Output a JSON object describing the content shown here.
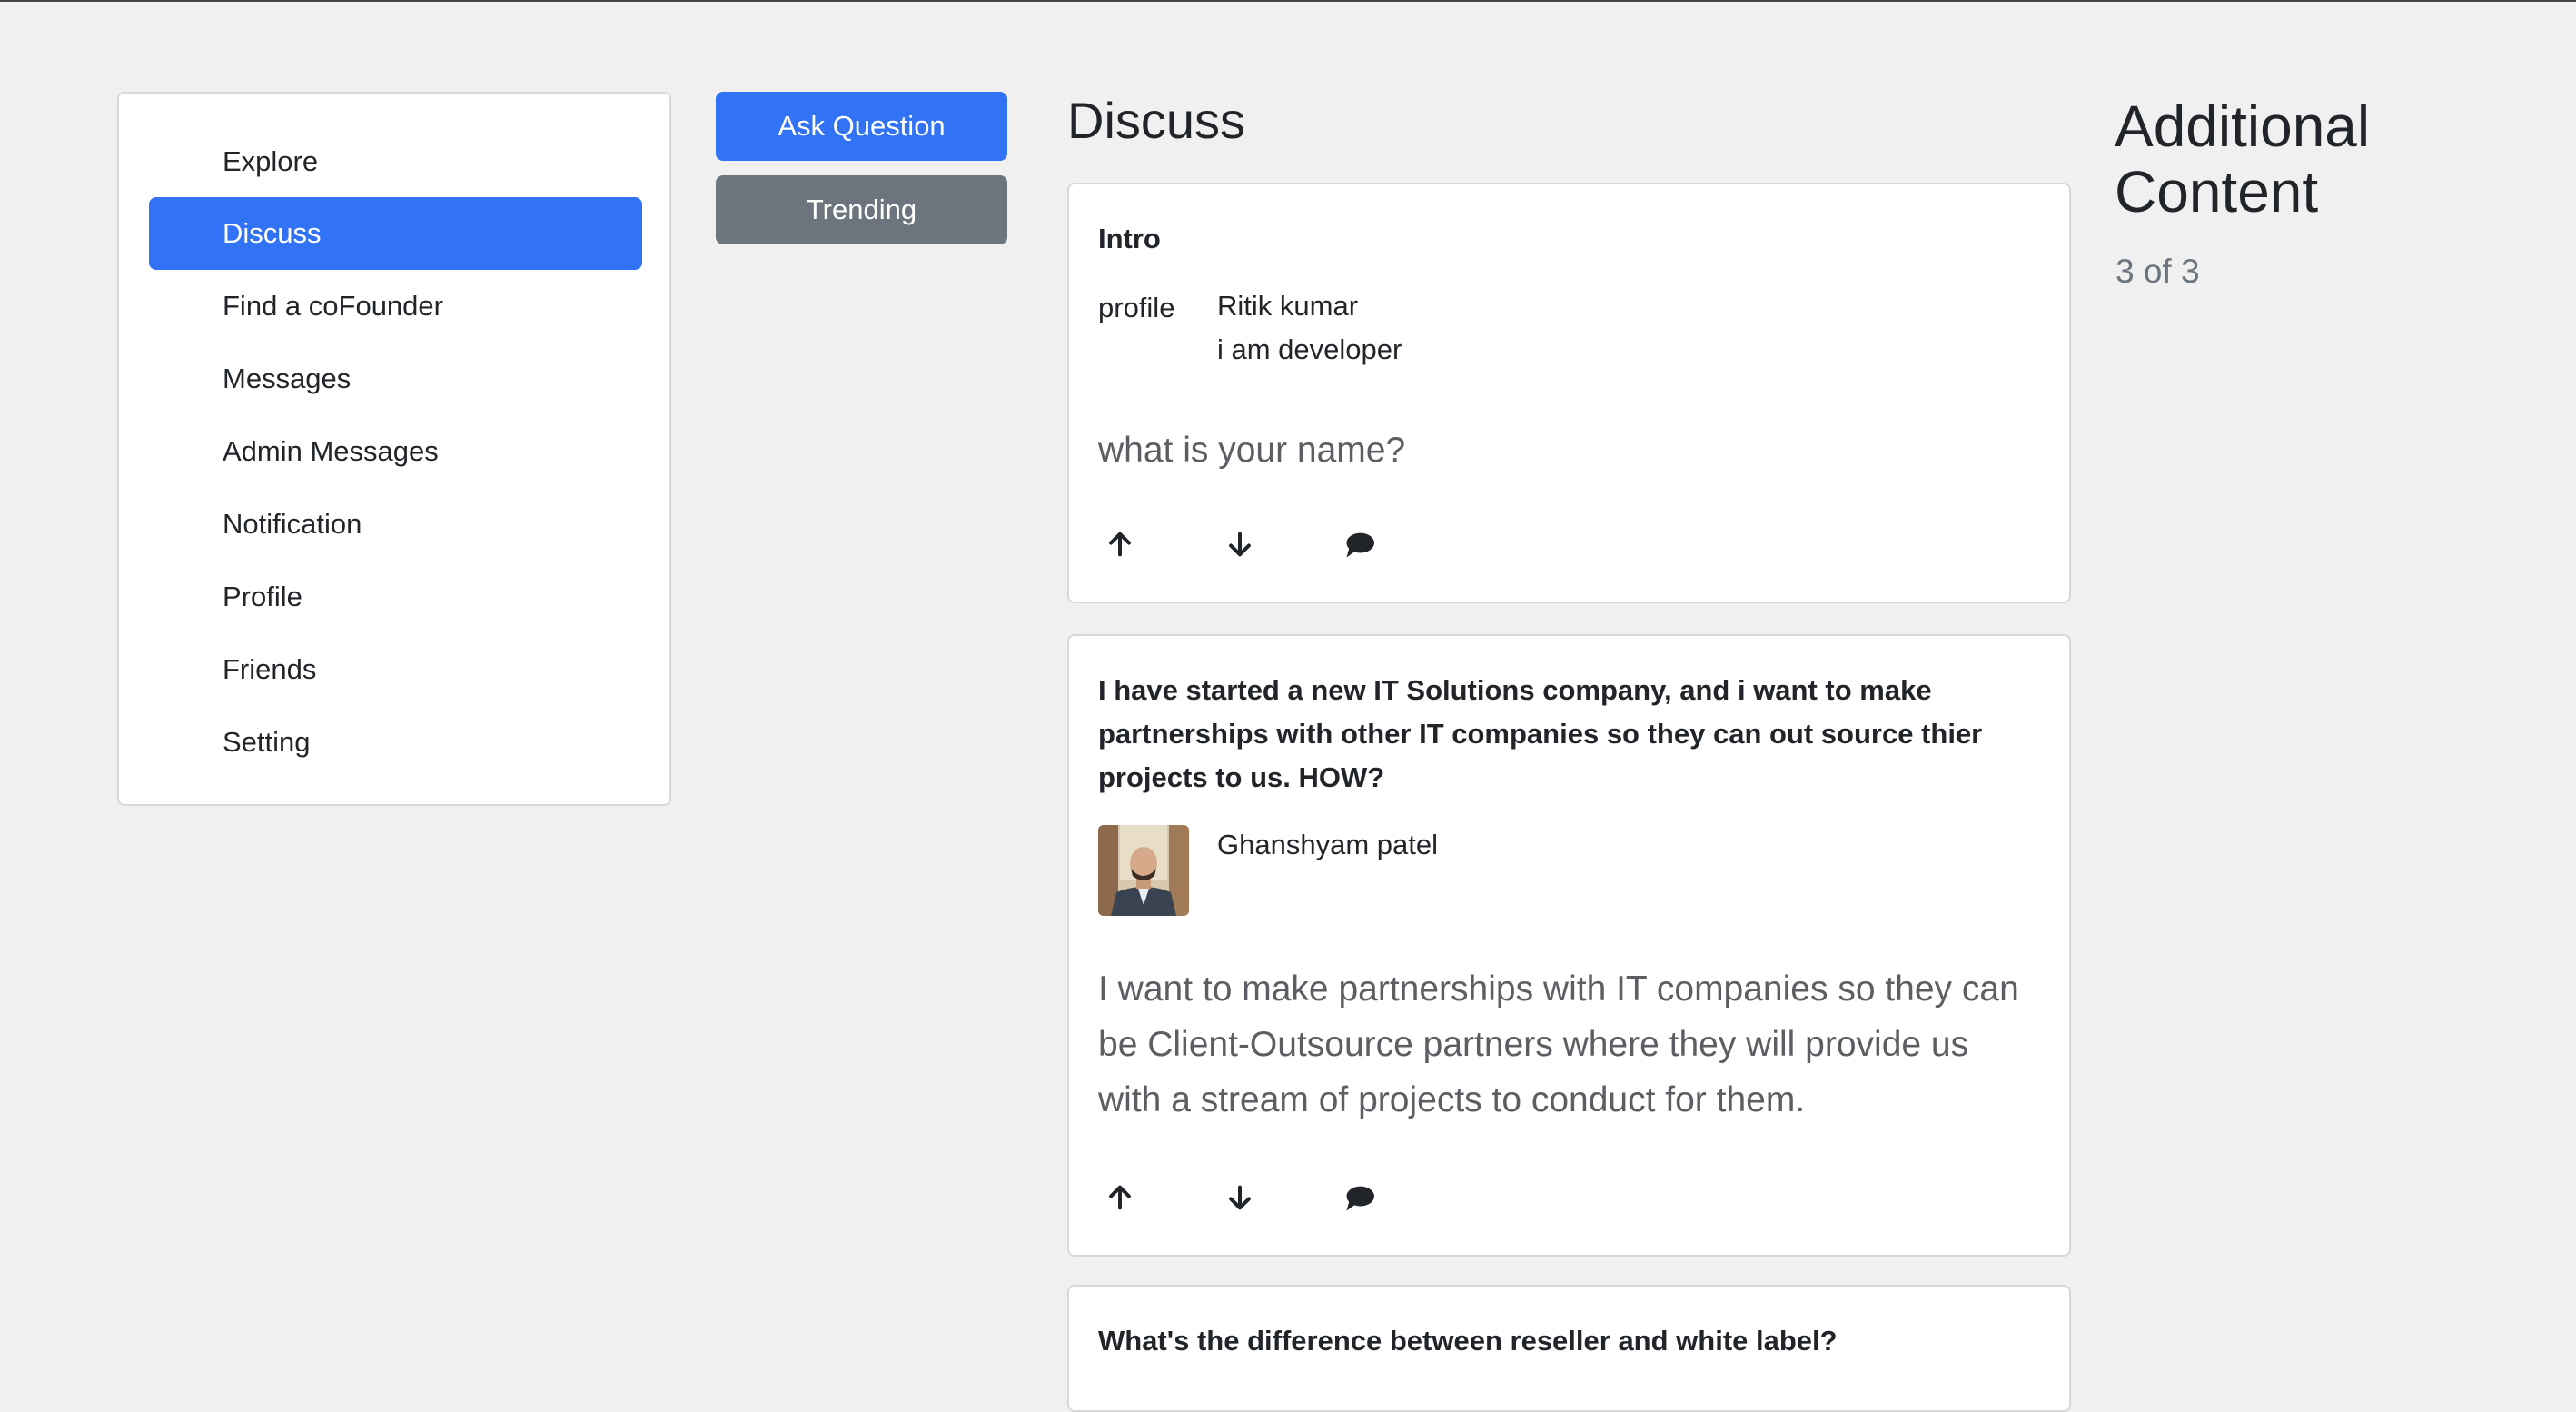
{
  "sidebar": {
    "items": [
      {
        "label": "Explore"
      },
      {
        "label": "Discuss",
        "active": true
      },
      {
        "label": "Find a coFounder"
      },
      {
        "label": "Messages"
      },
      {
        "label": "Admin Messages"
      },
      {
        "label": "Notification"
      },
      {
        "label": "Profile"
      },
      {
        "label": "Friends"
      },
      {
        "label": "Setting"
      }
    ]
  },
  "buttons": {
    "ask_question": "Ask Question",
    "trending": "Trending"
  },
  "main": {
    "title": "Discuss",
    "posts": [
      {
        "title": "Intro",
        "author": "Ritik kumar",
        "bio": "i am developer",
        "avatar_alt": "profile",
        "body": "what is your name?"
      },
      {
        "title": "I have started a new IT Solutions company, and i want to make partnerships with other IT companies so they can out source thier projects to us. HOW?",
        "author": "Ghanshyam patel",
        "body": "I want to make partnerships with IT companies so they can be Client-Outsource partners where they will provide us with a stream of projects to conduct for them."
      },
      {
        "title": "What's the difference between reseller and white label?"
      }
    ]
  },
  "aside": {
    "heading": "Additional Content",
    "pagination": "3 of 3"
  },
  "icons": {
    "upvote": "arrow-up-icon",
    "downvote": "arrow-down-icon",
    "comment": "comment-icon"
  },
  "colors": {
    "accent": "#3273f6",
    "secondary": "#6c757d",
    "background": "#f0f0f0"
  }
}
